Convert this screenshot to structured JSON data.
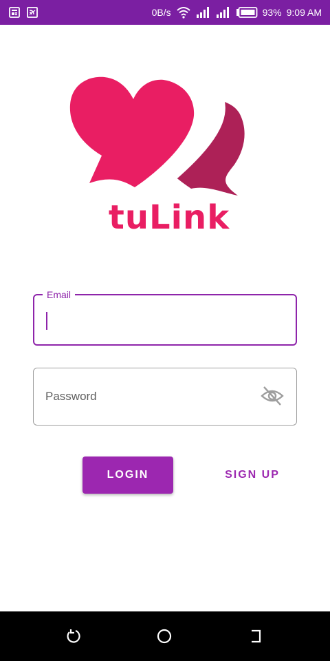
{
  "status_bar": {
    "net_speed": "0B/s",
    "battery": "93%",
    "time": "9:09 AM",
    "left_icons": [
      "news-icon",
      "cast-icon"
    ],
    "right_icons": [
      "wifi-icon",
      "signal-icon",
      "signal-icon-2",
      "battery-icon"
    ]
  },
  "logo": {
    "text": "tuLink",
    "colors": {
      "primary_heart": "#e91e63",
      "secondary_heart": "#ad2157"
    }
  },
  "form": {
    "email": {
      "label": "Email",
      "value": ""
    },
    "password": {
      "placeholder": "Password",
      "toggle_icon": "eye-off-icon"
    }
  },
  "actions": {
    "login_label": "LOGIN",
    "signup_label": "SIGN UP"
  },
  "nav_bar": {
    "icons": [
      "back-icon",
      "home-icon",
      "recent-apps-icon"
    ]
  },
  "colors": {
    "accent": "#9c27b0",
    "status_bar": "#7b1fa2"
  }
}
